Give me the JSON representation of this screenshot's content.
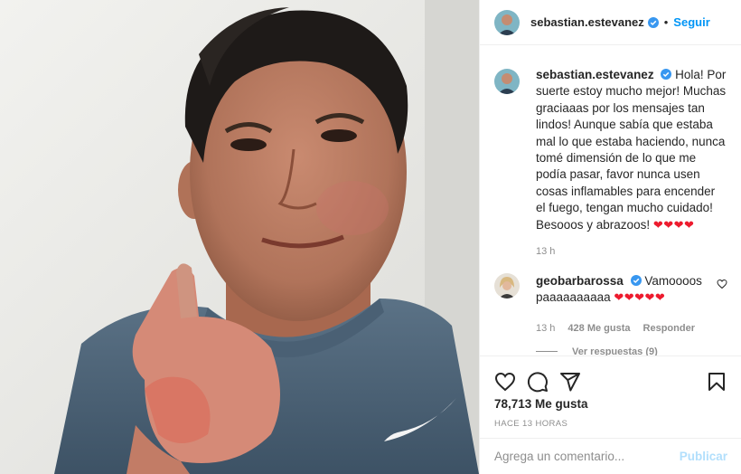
{
  "post": {
    "photo_alt": "selfie-thumbs-up",
    "author": {
      "username": "sebastian.estevanez",
      "verified": true,
      "follow_label": "Seguir",
      "separator": "•"
    },
    "caption": {
      "username": "sebastian.estevanez",
      "text": "Hola! Por suerte estoy mucho mejor! Muchas graciaaas por los mensajes tan lindos! Aunque sabía que estaba mal lo que estaba haciendo, nunca tomé dimensión de lo que me podía pasar, favor nunca usen cosas inflamables para encender el fuego, tengan mucho cuidado! Besooos y abrazoos!",
      "emoji": "❤❤❤❤",
      "time": "13 h"
    },
    "comments": [
      {
        "username": "geobarbarossa",
        "verified": true,
        "text": "Vamoooos paaaaaaaaaa",
        "emoji": "❤❤❤❤❤",
        "time": "13 h",
        "likes": "428 Me gusta",
        "reply_label": "Responder",
        "view_replies": "Ver respuestas (9)"
      }
    ],
    "likes_count": "78,713 Me gusta",
    "time_ago": "HACE 13 HORAS",
    "composer": {
      "placeholder": "Agrega un comentario...",
      "publish_label": "Publicar"
    }
  },
  "icons": {
    "like": "heart-outline-icon",
    "comment": "comment-bubble-icon",
    "share": "paper-plane-icon",
    "save": "bookmark-icon",
    "verified": "verified-badge-icon",
    "comment_like": "small-heart-icon"
  },
  "colors": {
    "accent": "#0095f6",
    "verified": "#3897f0",
    "heart": "#ed1b2e",
    "muted": "#8e8e8e",
    "publish_disabled": "#b2dffc",
    "border": "#efefef"
  }
}
